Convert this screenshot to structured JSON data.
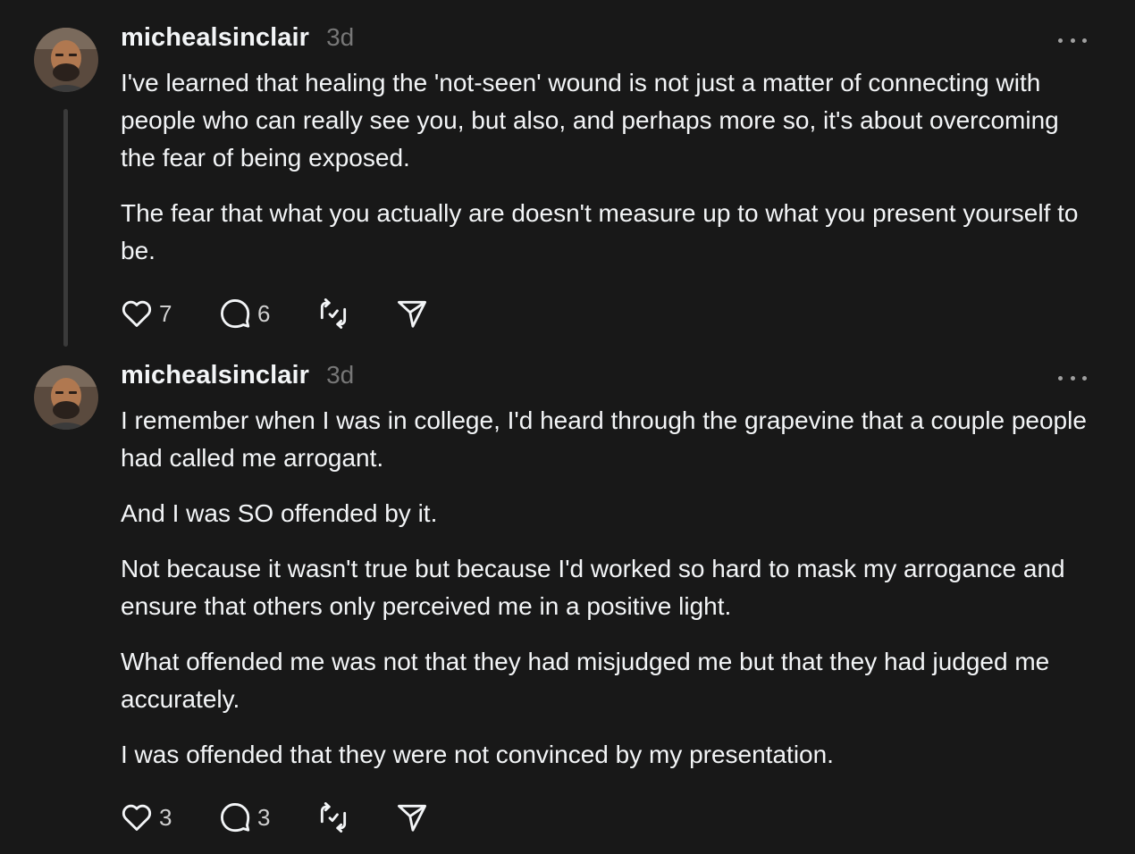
{
  "posts": [
    {
      "username": "michealsinclair",
      "time": "3d",
      "paragraphs": [
        "I've learned that healing the 'not-seen' wound is not just a matter of connecting with people who can really see you, but also, and perhaps more so, it's about overcoming the fear of being exposed.",
        "The fear that what you actually are doesn't measure up to what you present yourself to be."
      ],
      "likes": "7",
      "replies": "6",
      "icons": [
        "heart-icon",
        "comment-icon",
        "repost-icon",
        "share-icon",
        "more-icon"
      ]
    },
    {
      "username": "michealsinclair",
      "time": "3d",
      "paragraphs": [
        "I remember when I was in college, I'd heard through the grapevine that a couple people had called me arrogant.",
        "And I was SO offended by it.",
        "Not because it wasn't true but because I'd worked so hard to mask my arrogance and ensure that others only perceived me in a positive light.",
        "What offended me was not that they had misjudged me but that they had judged me accurately.",
        "I was offended that they were not convinced by my presentation."
      ],
      "likes": "3",
      "replies": "3",
      "icons": [
        "heart-icon",
        "comment-icon",
        "repost-icon",
        "share-icon",
        "more-icon"
      ]
    }
  ],
  "colors": {
    "background": "#181818",
    "text": "#f3f5f7",
    "muted": "#777777",
    "thread_line": "#3a3a3a"
  }
}
